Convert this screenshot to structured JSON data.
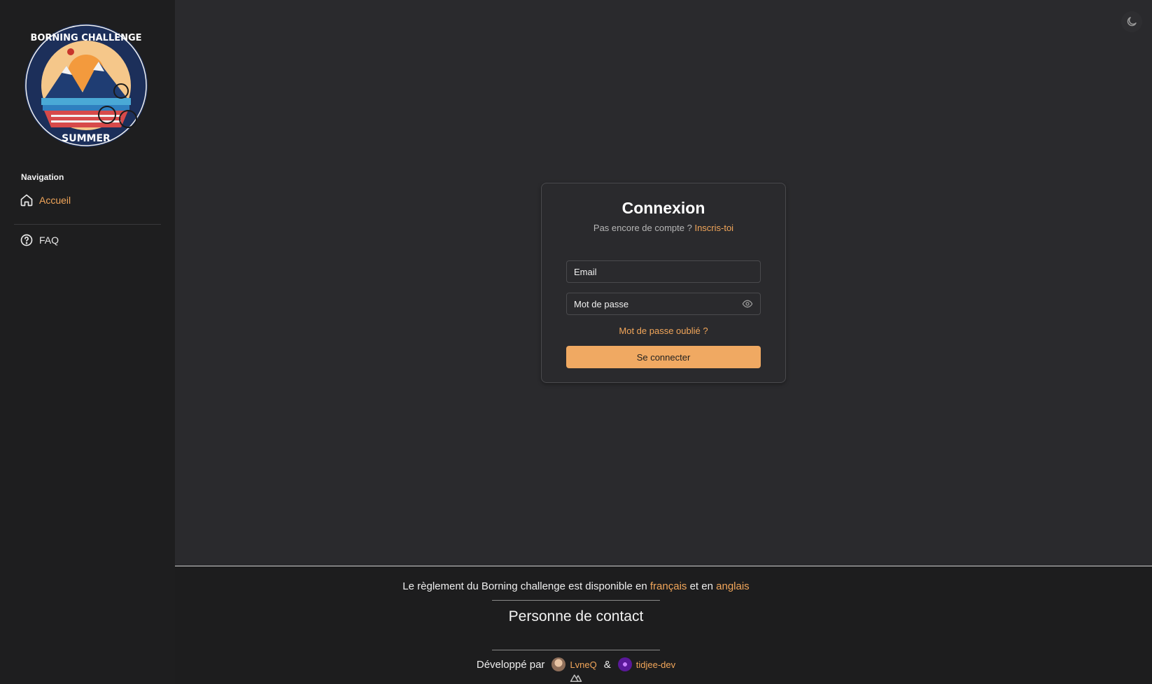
{
  "sidebar": {
    "logo_text_top": "BORNING CHALLENGE",
    "logo_text_bottom": "SUMMER",
    "nav_heading": "Navigation",
    "items": [
      {
        "label": "Accueil",
        "icon": "home-icon"
      },
      {
        "label": "FAQ",
        "icon": "help-circle-icon"
      }
    ]
  },
  "header": {
    "theme_toggle_icon": "moon-icon"
  },
  "login": {
    "title": "Connexion",
    "no_account_text": "Pas encore de compte ?",
    "signup_link": "Inscris-toi",
    "email_placeholder": "Email",
    "password_placeholder": "Mot de passe",
    "password_toggle_icon": "eye-icon",
    "forgot_link": "Mot de passe oublié ?",
    "submit_label": "Se connecter"
  },
  "footer": {
    "rules_prefix": "Le règlement du Borning challenge est disponible en",
    "rules_link_fr": "français",
    "rules_middle": "et en",
    "rules_link_en": "anglais",
    "contact_title": "Personne de contact",
    "dev_prefix": "Développé par",
    "dev_1": "LvneQ",
    "dev_separator": "&",
    "dev_2": "tidjee-dev",
    "framework_icon": "nuxt-icon"
  },
  "colors": {
    "accent": "#f2a65a",
    "background": "#2a2a2d",
    "sidebar": "#1e1e1f",
    "footer": "#1d1d1e",
    "button": "#f0a962"
  }
}
